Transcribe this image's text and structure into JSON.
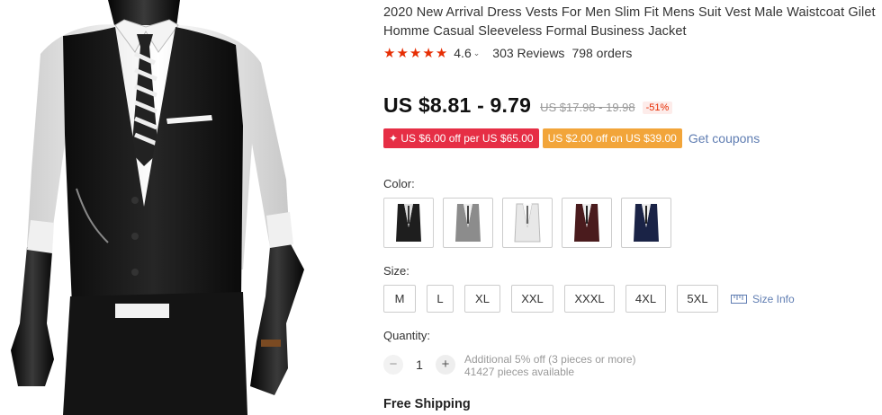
{
  "product": {
    "title": "2020 New Arrival Dress Vests For Men Slim Fit Mens Suit Vest Male Waistcoat Gilet Homme Casual Sleeveless Formal Business Jacket",
    "rating": "4.6",
    "rating_stars": 5,
    "reviews": "303 Reviews",
    "orders": "798 orders"
  },
  "price": {
    "current": "US $8.81 - 9.79",
    "original": "US $17.98 - 19.98",
    "discount": "-51%"
  },
  "coupons": {
    "store_coupon": "✦ US $6.00 off per US $65.00",
    "select_coupon": "US $2.00 off on US $39.00",
    "get_coupons": "Get coupons"
  },
  "color": {
    "label": "Color:",
    "options": [
      {
        "name": "Black",
        "hex": "#1e1e1e"
      },
      {
        "name": "Gray",
        "hex": "#8c8c8c"
      },
      {
        "name": "White",
        "hex": "#e8e8e8"
      },
      {
        "name": "Wine Red",
        "hex": "#4a1b1d"
      },
      {
        "name": "Navy",
        "hex": "#1a2346"
      }
    ]
  },
  "size": {
    "label": "Size:",
    "options": [
      "M",
      "L",
      "XL",
      "XXL",
      "XXXL",
      "4XL",
      "5XL"
    ],
    "size_info": "Size Info"
  },
  "quantity": {
    "label": "Quantity:",
    "minus": "−",
    "value": "1",
    "plus": "+",
    "note": "Additional 5% off (3 pieces or more)",
    "available": "41427 pieces available"
  },
  "shipping": {
    "label": "Free Shipping"
  },
  "colors": {
    "accent_red": "#e62e04",
    "coupon_red": "#e62e45",
    "coupon_orange": "#f2a53a",
    "link_blue": "#5f7db2"
  }
}
